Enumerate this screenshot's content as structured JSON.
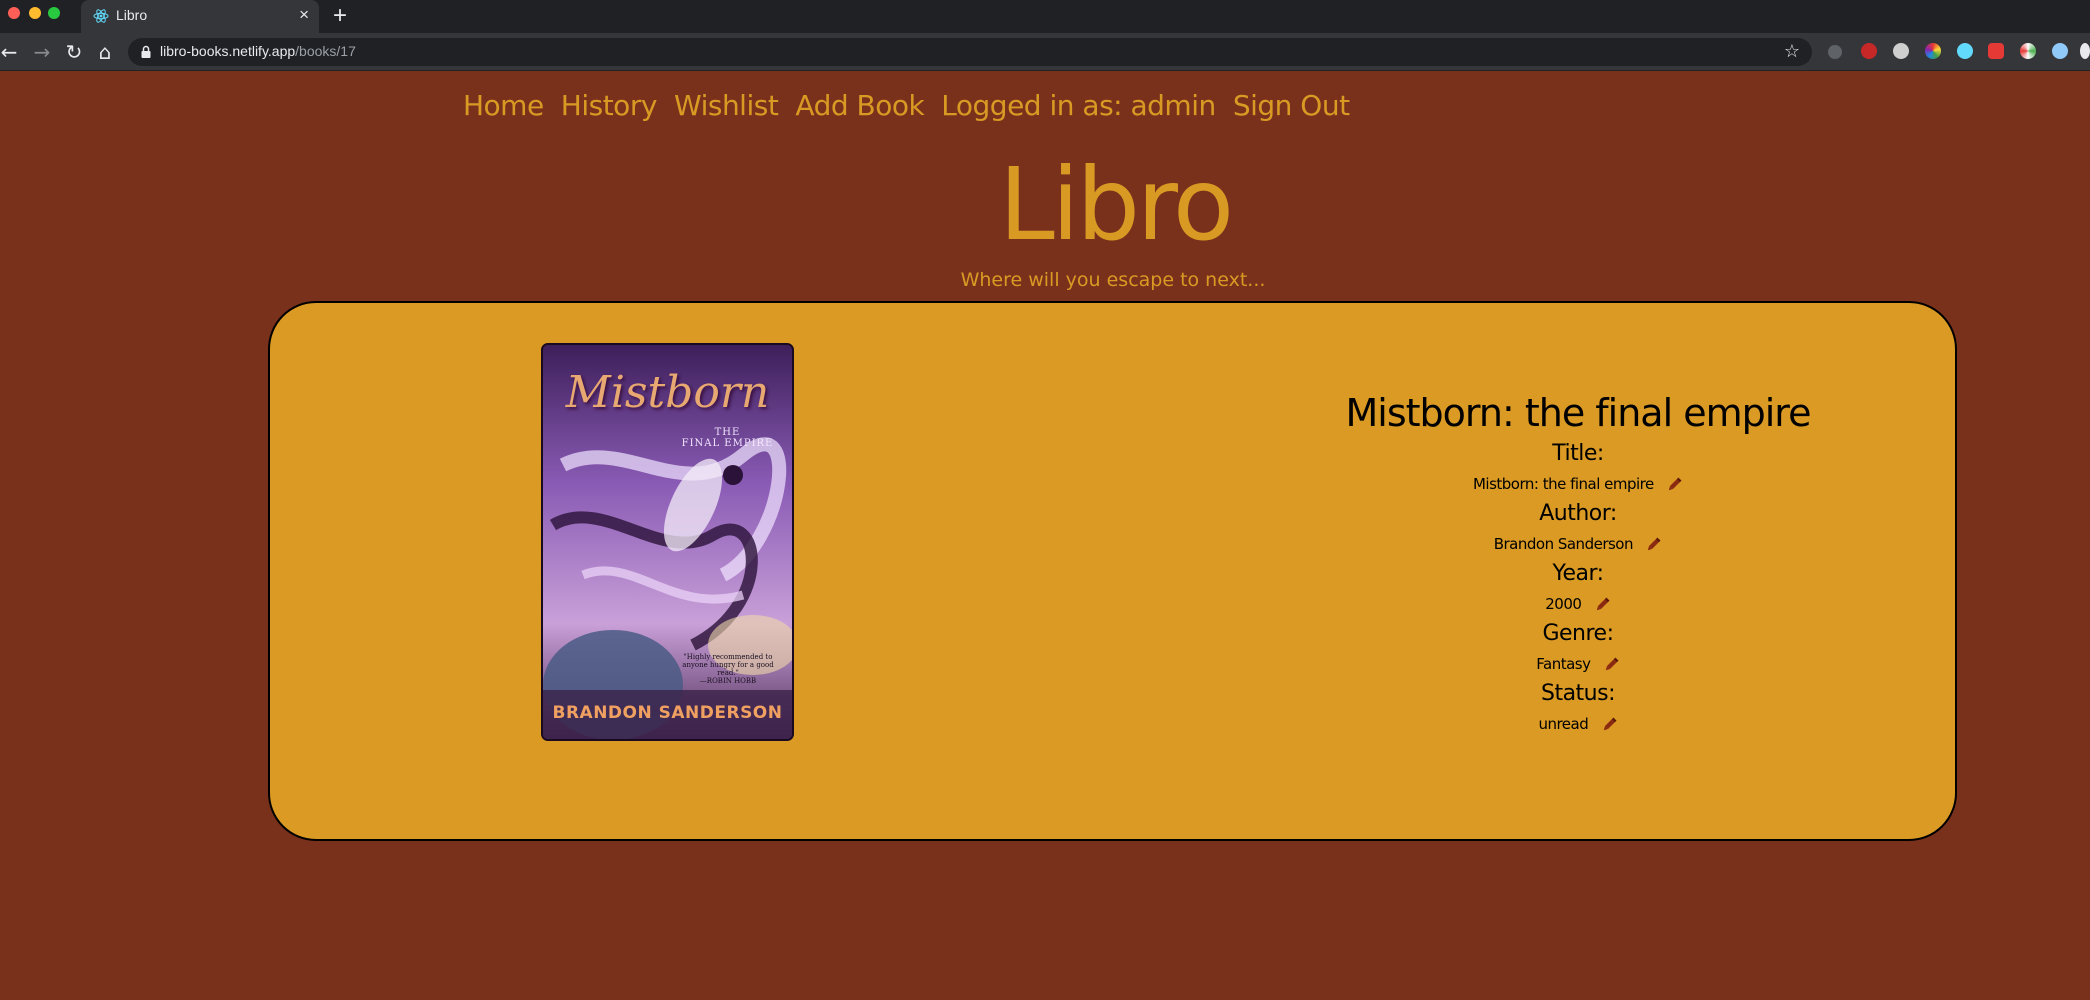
{
  "browser": {
    "tab_title": "Libro",
    "tab_close": "×",
    "new_tab": "+",
    "url_host": "libro-books.netlify.app",
    "url_path": "/books/17"
  },
  "nav": {
    "home": "Home",
    "history": "History",
    "wishlist": "Wishlist",
    "add_book": "Add Book",
    "logged_in": "Logged in as: admin",
    "sign_out": "Sign Out"
  },
  "header": {
    "logo": "Libro",
    "tagline": "Where will you escape to next..."
  },
  "cover": {
    "title": "Mistborn",
    "subtitle_line1": "THE",
    "subtitle_line2": "FINAL EMPIRE",
    "quote_line1": "\"Highly recommended to",
    "quote_line2": "anyone hungry for a good read.\"",
    "quote_author": "—ROBIN HOBB",
    "author": "BRANDON SANDERSON"
  },
  "book": {
    "heading": "Mistborn: the final empire",
    "fields": [
      {
        "label": "Title:",
        "value": "Mistborn: the final empire"
      },
      {
        "label": "Author:",
        "value": "Brandon Sanderson"
      },
      {
        "label": "Year:",
        "value": "2000"
      },
      {
        "label": "Genre:",
        "value": "Fantasy"
      },
      {
        "label": "Status:",
        "value": "unread"
      }
    ]
  },
  "colors": {
    "page_bg": "#7a311c",
    "accent": "#d99a24",
    "card_bg": "#da9a24",
    "edit_icon": "#8a2a10"
  },
  "icons": {
    "edit": "pencil-icon"
  }
}
